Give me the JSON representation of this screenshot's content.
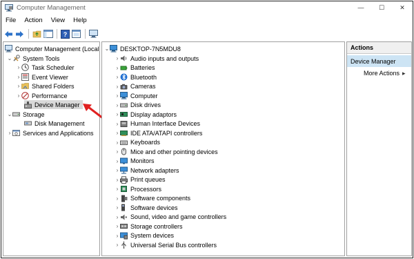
{
  "window": {
    "title": "Computer Management",
    "controls": {
      "minimize": "—",
      "maximize": "☐",
      "close": "✕"
    }
  },
  "menu": [
    "File",
    "Action",
    "View",
    "Help"
  ],
  "toolbar": {
    "buttons": [
      "back-icon",
      "forward-icon",
      "up-folder-icon",
      "show-hide-tree-icon",
      "help-icon",
      "properties-icon",
      "console-icon"
    ]
  },
  "tree": {
    "root": "Computer Management (Local",
    "system_tools": "System Tools",
    "task_scheduler": "Task Scheduler",
    "event_viewer": "Event Viewer",
    "shared_folders": "Shared Folders",
    "performance": "Performance",
    "device_manager": "Device Manager",
    "storage": "Storage",
    "disk_management": "Disk Management",
    "services_apps": "Services and Applications"
  },
  "devices": {
    "computer_name": "DESKTOP-7N5MDU8",
    "categories": [
      "Audio inputs and outputs",
      "Batteries",
      "Bluetooth",
      "Cameras",
      "Computer",
      "Disk drives",
      "Display adaptors",
      "Human Interface Devices",
      "IDE ATA/ATAPI controllers",
      "Keyboards",
      "Mice and other pointing devices",
      "Monitors",
      "Network adapters",
      "Print queues",
      "Processors",
      "Software components",
      "Software devices",
      "Sound, video and game controllers",
      "Storage controllers",
      "System devices",
      "Universal Serial Bus controllers"
    ]
  },
  "actions": {
    "header": "Actions",
    "section": "Device Manager",
    "more": "More Actions",
    "more_arrow": "▸"
  },
  "colors": {
    "selection": "#d9d9d9",
    "actions_section": "#cde4f4",
    "annotation_arrow": "#e02020"
  }
}
